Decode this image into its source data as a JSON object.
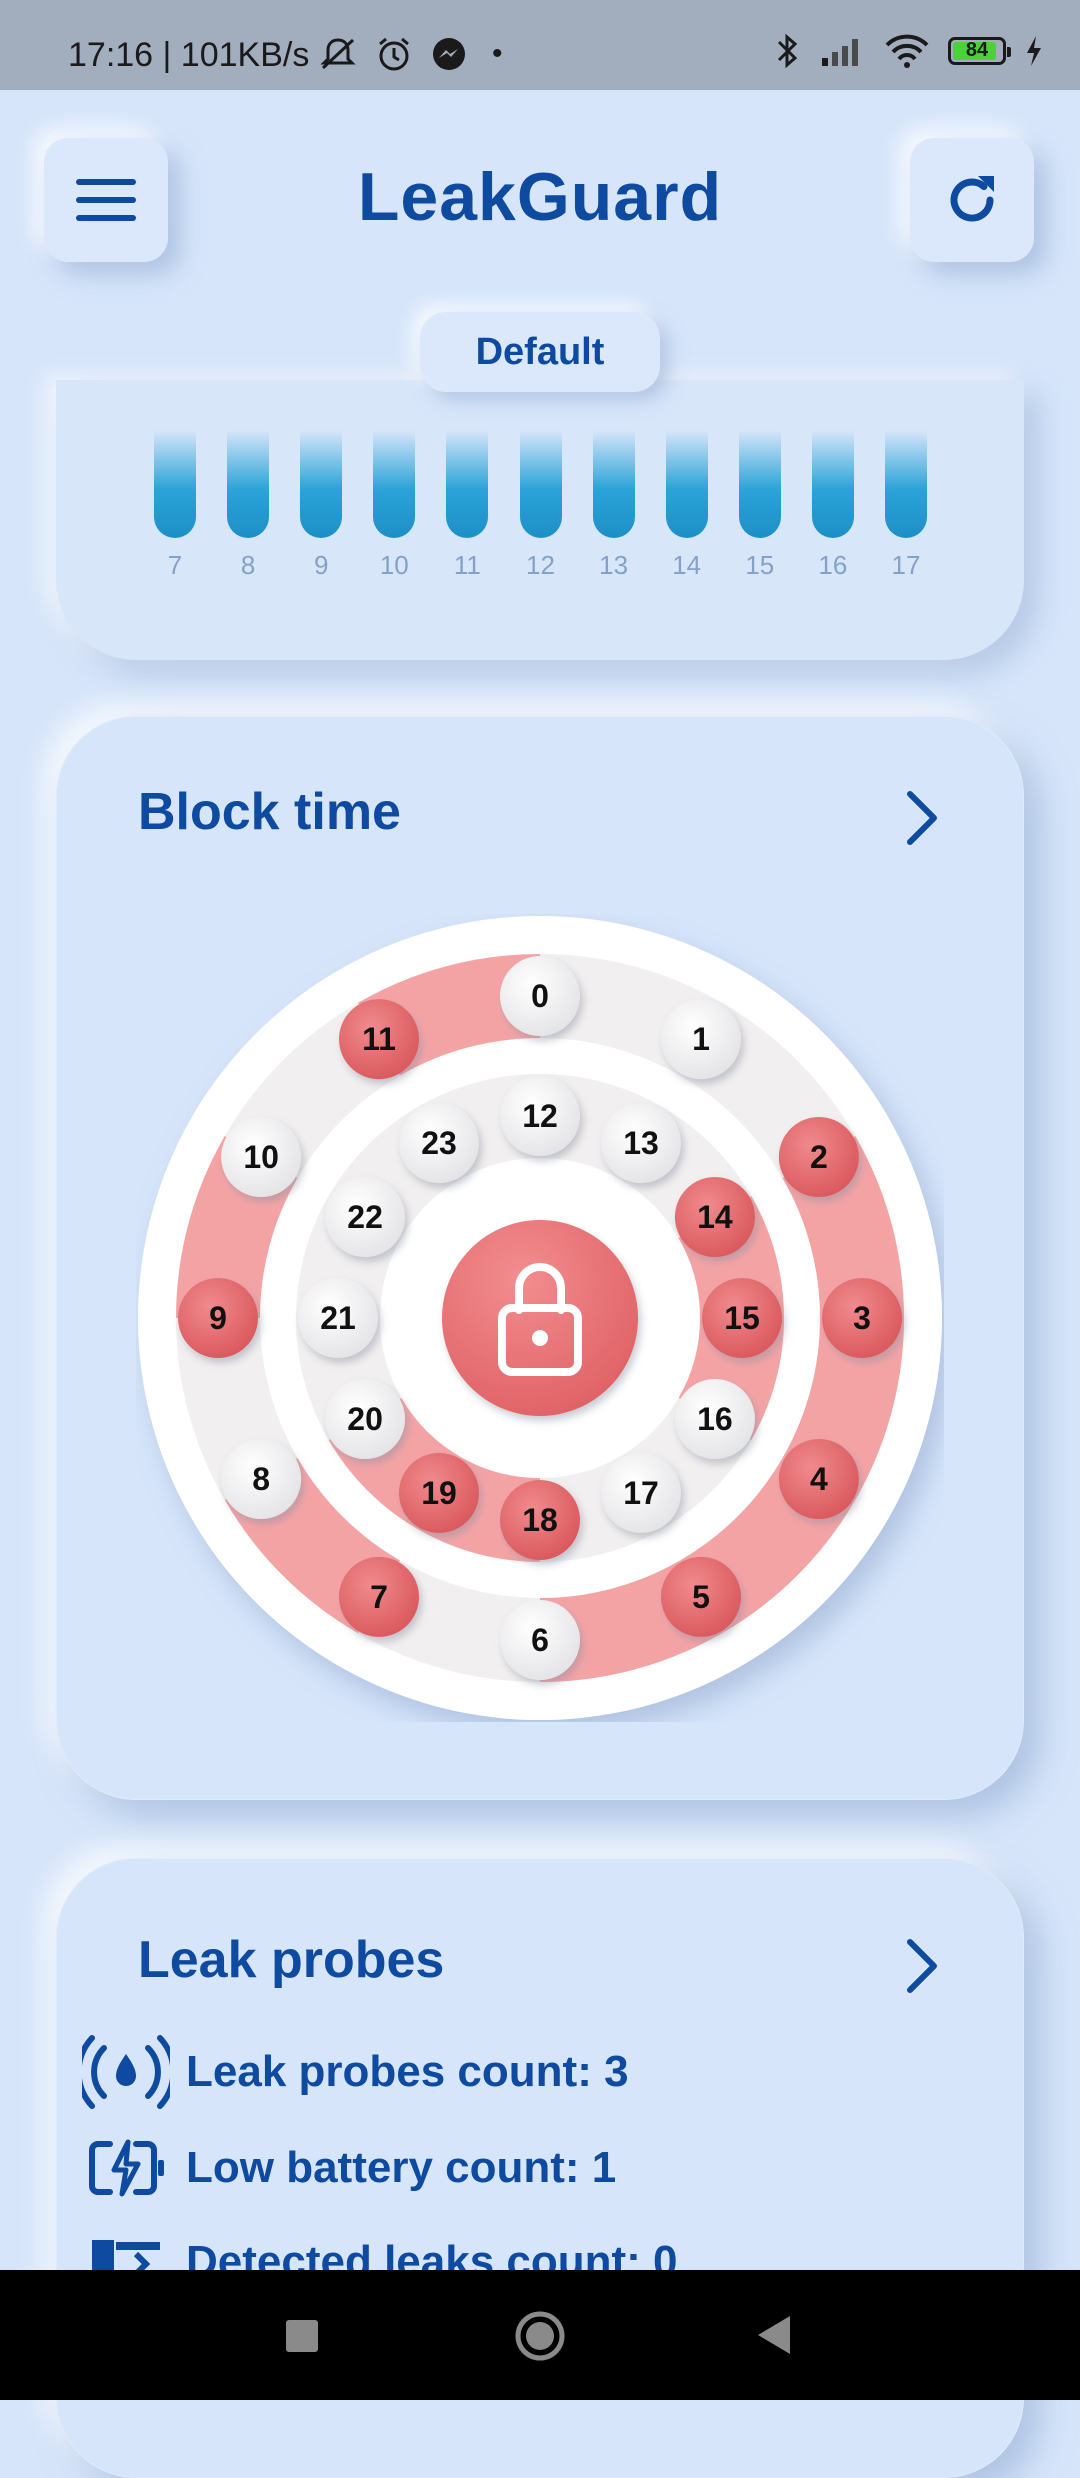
{
  "status_bar": {
    "time_speed": "17:16 | 101KB/s",
    "battery": "84"
  },
  "header": {
    "title": "LeakGuard"
  },
  "profile": {
    "label": "Default"
  },
  "usage_chart": {
    "hours": [
      "7",
      "8",
      "9",
      "10",
      "11",
      "12",
      "13",
      "14",
      "15",
      "16",
      "17"
    ]
  },
  "block_time": {
    "title": "Block time",
    "outer_hours": [
      "0",
      "1",
      "2",
      "3",
      "4",
      "5",
      "6",
      "7",
      "8",
      "9",
      "10",
      "11"
    ],
    "inner_hours": [
      "12",
      "13",
      "14",
      "15",
      "16",
      "17",
      "18",
      "19",
      "20",
      "21",
      "22",
      "23"
    ],
    "blocked_outer": [
      "2",
      "3",
      "4",
      "5",
      "7",
      "9",
      "11"
    ],
    "blocked_inner": [
      "14",
      "15",
      "18",
      "19"
    ],
    "colors": {
      "blocked": "#e2676b",
      "arc": "#f4a3a5",
      "free": "#f1efef"
    }
  },
  "leak_probes": {
    "title": "Leak probes",
    "rows": [
      {
        "icon": "water-signal-icon",
        "text": "Leak probes count: 3"
      },
      {
        "icon": "low-battery-icon",
        "text": "Low battery count: 1"
      },
      {
        "icon": "detected-leak-icon",
        "text": "Detected leaks count: 0"
      }
    ]
  },
  "colors": {
    "accent": "#0e4aa0",
    "background": "#d6e5fa"
  }
}
